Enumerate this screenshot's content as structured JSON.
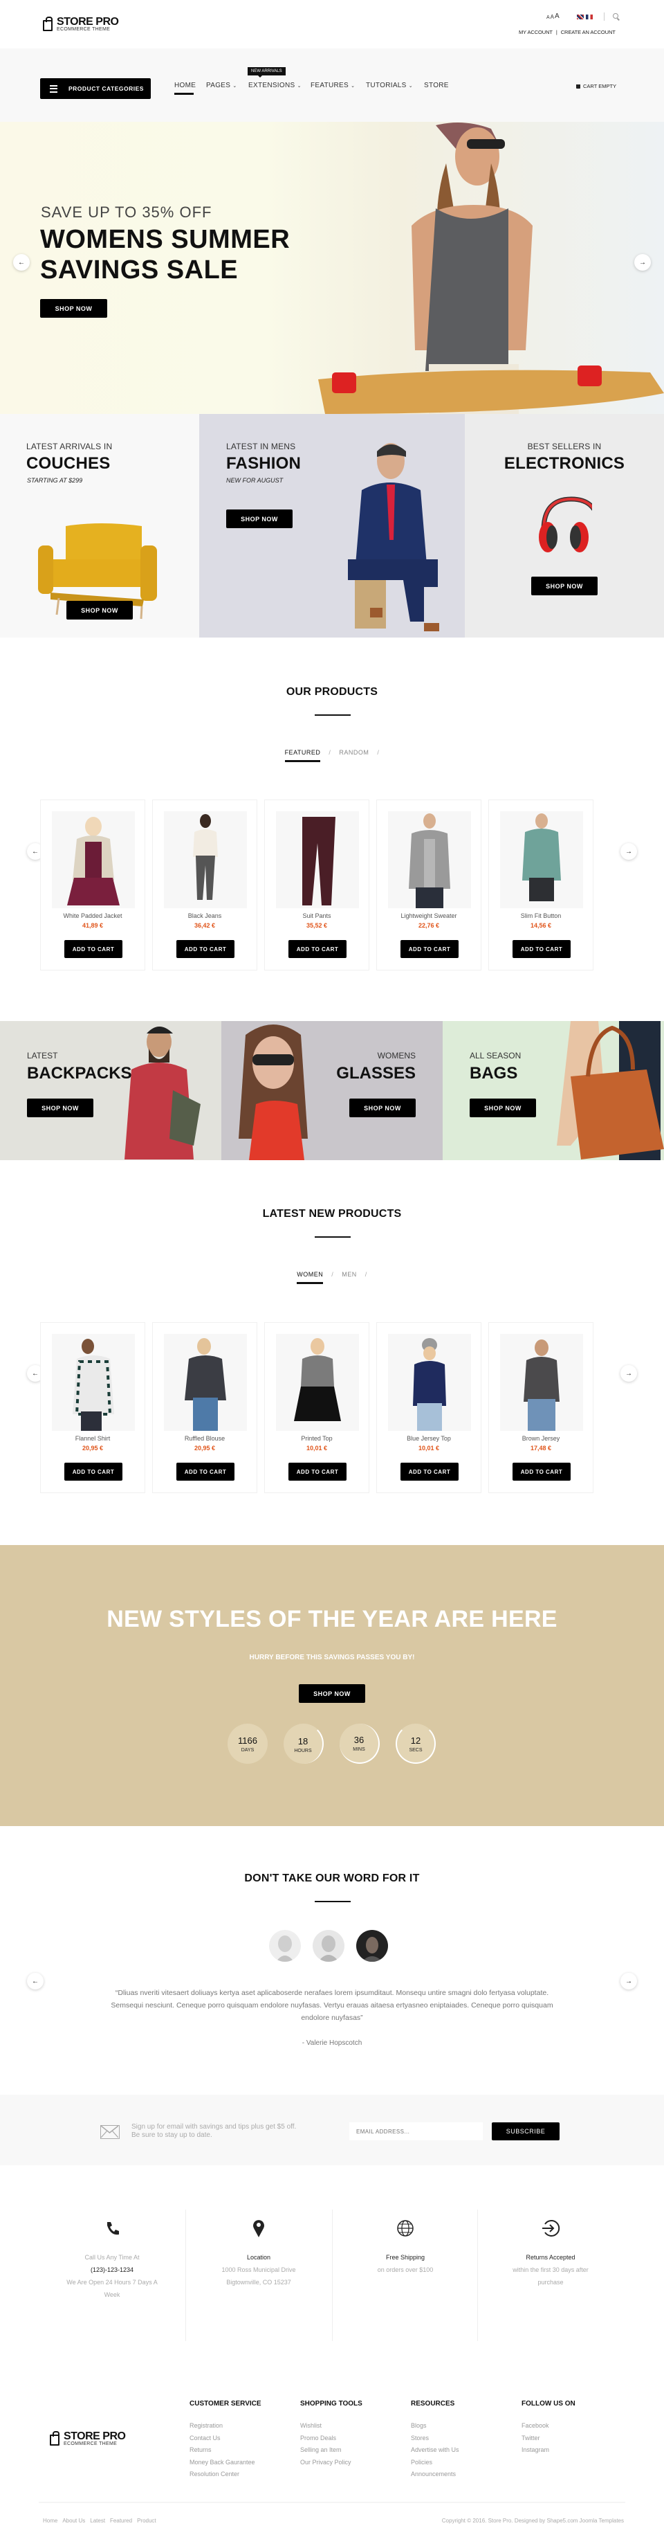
{
  "header": {
    "logo_title": "STORE PRO",
    "logo_subtitle": "ECOMMERCE THEME",
    "font_size_controls": [
      "A",
      "A",
      "A"
    ],
    "languages": [
      "en-flag-icon",
      "fr-flag-icon"
    ],
    "account_link": "MY ACCOUNT",
    "separator": "|",
    "create_account_link": "CREATE AN ACCOUNT"
  },
  "nav": {
    "categories_button": "PRODUCT CATEGORIES",
    "items": [
      {
        "label": "HOME",
        "active": true
      },
      {
        "label": "PAGES",
        "dropdown": true
      },
      {
        "label": "EXTENSIONS",
        "dropdown": true
      },
      {
        "label": "FEATURES",
        "dropdown": true
      },
      {
        "label": "TUTORIALS",
        "dropdown": true
      },
      {
        "label": "STORE"
      }
    ],
    "tooltip_badge": "NEW ARRIVALS",
    "cart_label": "CART EMPTY",
    "dropdown_glyph": "⌄"
  },
  "hero": {
    "kicker": "SAVE UP TO 35% OFF",
    "title_line1": "WOMENS SUMMER",
    "title_line2": "SAVINGS SALE",
    "button": "SHOP NOW",
    "prev_icon": "←",
    "next_icon": "→"
  },
  "tiles": [
    {
      "kicker": "LATEST ARRIVALS IN",
      "title": "COUCHES",
      "subtitle": "STARTING AT $299",
      "button": "SHOP NOW",
      "bg": "#f8f8f8"
    },
    {
      "kicker": "LATEST IN MENS",
      "title": "FASHION",
      "subtitle": "NEW FOR AUGUST",
      "button": "SHOP NOW",
      "bg": "#dcdce4"
    },
    {
      "kicker": "BEST SELLERS IN",
      "title": "ELECTRONICS",
      "subtitle": "",
      "button": "SHOP NOW",
      "bg": "#ececec"
    }
  ],
  "our_products": {
    "title": "OUR PRODUCTS",
    "tabs": [
      {
        "label": "FEATURED",
        "active": true
      },
      {
        "label": "RANDOM",
        "active": false
      }
    ],
    "tab_sep": "/",
    "products": [
      {
        "name": "White Padded Jacket",
        "price": "41,89 €",
        "button": "ADD TO CART"
      },
      {
        "name": "Black Jeans",
        "price": "36,42 €",
        "button": "ADD TO CART"
      },
      {
        "name": "Suit Pants",
        "price": "35,52 €",
        "button": "ADD TO CART"
      },
      {
        "name": "Lightweight Sweater",
        "price": "22,76 €",
        "button": "ADD TO CART"
      },
      {
        "name": "Slim Fit Button",
        "price": "14,56 €",
        "button": "ADD TO CART"
      }
    ]
  },
  "banners": [
    {
      "kicker": "LATEST",
      "title": "BACKPACKS",
      "button": "SHOP NOW",
      "bg": "#e2e2dc"
    },
    {
      "kicker": "WOMENS",
      "title": "GLASSES",
      "button": "SHOP NOW",
      "bg": "#c9c6cb"
    },
    {
      "kicker": "ALL SEASON",
      "title": "BAGS",
      "button": "SHOP NOW",
      "bg": "#ddecd8"
    }
  ],
  "latest_products": {
    "title": "LATEST NEW PRODUCTS",
    "tabs": [
      {
        "label": "WOMEN",
        "active": true
      },
      {
        "label": "MEN",
        "active": false
      }
    ],
    "tab_sep": "/",
    "products": [
      {
        "name": "Flannel Shirt",
        "price": "20,95 €",
        "button": "ADD TO CART"
      },
      {
        "name": "Ruffled Blouse",
        "price": "20,95 €",
        "button": "ADD TO CART"
      },
      {
        "name": "Printed Top",
        "price": "10,01 €",
        "button": "ADD TO CART"
      },
      {
        "name": "Blue Jersey Top",
        "price": "10,01 €",
        "button": "ADD TO CART"
      },
      {
        "name": "Brown Jersey",
        "price": "17,48 €",
        "button": "ADD TO CART"
      }
    ]
  },
  "promo": {
    "title": "NEW STYLES OF THE YEAR ARE HERE",
    "subtitle": "HURRY BEFORE THIS SAVINGS PASSES YOU BY!",
    "button": "SHOP NOW",
    "countdown": [
      {
        "value": "1166",
        "label": "DAYS"
      },
      {
        "value": "18",
        "label": "HOURS"
      },
      {
        "value": "36",
        "label": "MINS"
      },
      {
        "value": "12",
        "label": "SECS"
      }
    ],
    "bg": "#d9c8a3"
  },
  "testimonials": {
    "title": "DON'T TAKE OUR WORD FOR IT",
    "quote": "“Dliuas nveriti vitesaert doliuays kertya aset aplicaboserde nerafaes lorem ipsumditaut. Monsequ untire smagni dolo fertyasa voluptate. Semsequi nesciunt. Ceneque porro quisquam endolore nuyfasas. Vertyu erauas aitaesa ertyasneo eniptaiades. Ceneque porro quisquam endolore nuyfasas”",
    "author": "- Valerie Hopscotch"
  },
  "newsletter": {
    "text_line1": "Sign up for email with savings and tips plus get $5 off.",
    "text_line2": "Be sure to stay up to date.",
    "email_placeholder": "EMAIL ADDRESS...",
    "button": "SUBSCRIBE"
  },
  "info": [
    {
      "icon": "phone-icon",
      "line1": "Call Us Any Time At",
      "line2": "(123)-123-1234",
      "line3": "We Are Open 24 Hours 7 Days A Week"
    },
    {
      "icon": "map-pin-icon",
      "line1": "Location",
      "line2": "1000 Ross Municipal Drive",
      "line3": "Bigtownville, CO 15237"
    },
    {
      "icon": "globe-icon",
      "line1": "Free Shipping",
      "line2": "on orders over $100",
      "line3": ""
    },
    {
      "icon": "return-icon",
      "line1": "Returns Accepted",
      "line2": "within the first 30 days after purchase",
      "line3": ""
    }
  ],
  "footer": {
    "columns": [
      {
        "title": "CUSTOMER SERVICE",
        "links": [
          "Registration",
          "Contact Us",
          "Returns",
          "Money Back Gaurantee",
          "Resolution Center"
        ]
      },
      {
        "title": "SHOPPING TOOLS",
        "links": [
          "Wishlist",
          "Promo Deals",
          "Selling an Item",
          "Our Privacy Policy"
        ]
      },
      {
        "title": "RESOURCES",
        "links": [
          "Blogs",
          "Stores",
          "Advertise with Us",
          "Policies",
          "Announcements"
        ]
      },
      {
        "title": "FOLLOW US ON",
        "links": [
          "Facebook",
          "Twitter",
          "Instagram"
        ]
      }
    ],
    "bottom_links": [
      "Home",
      "About Us",
      "Latest",
      "Featured",
      "Product"
    ],
    "copyright": "Copyright © 2016. Store Pro. Designed by Shape5.com Joomla Templates"
  }
}
